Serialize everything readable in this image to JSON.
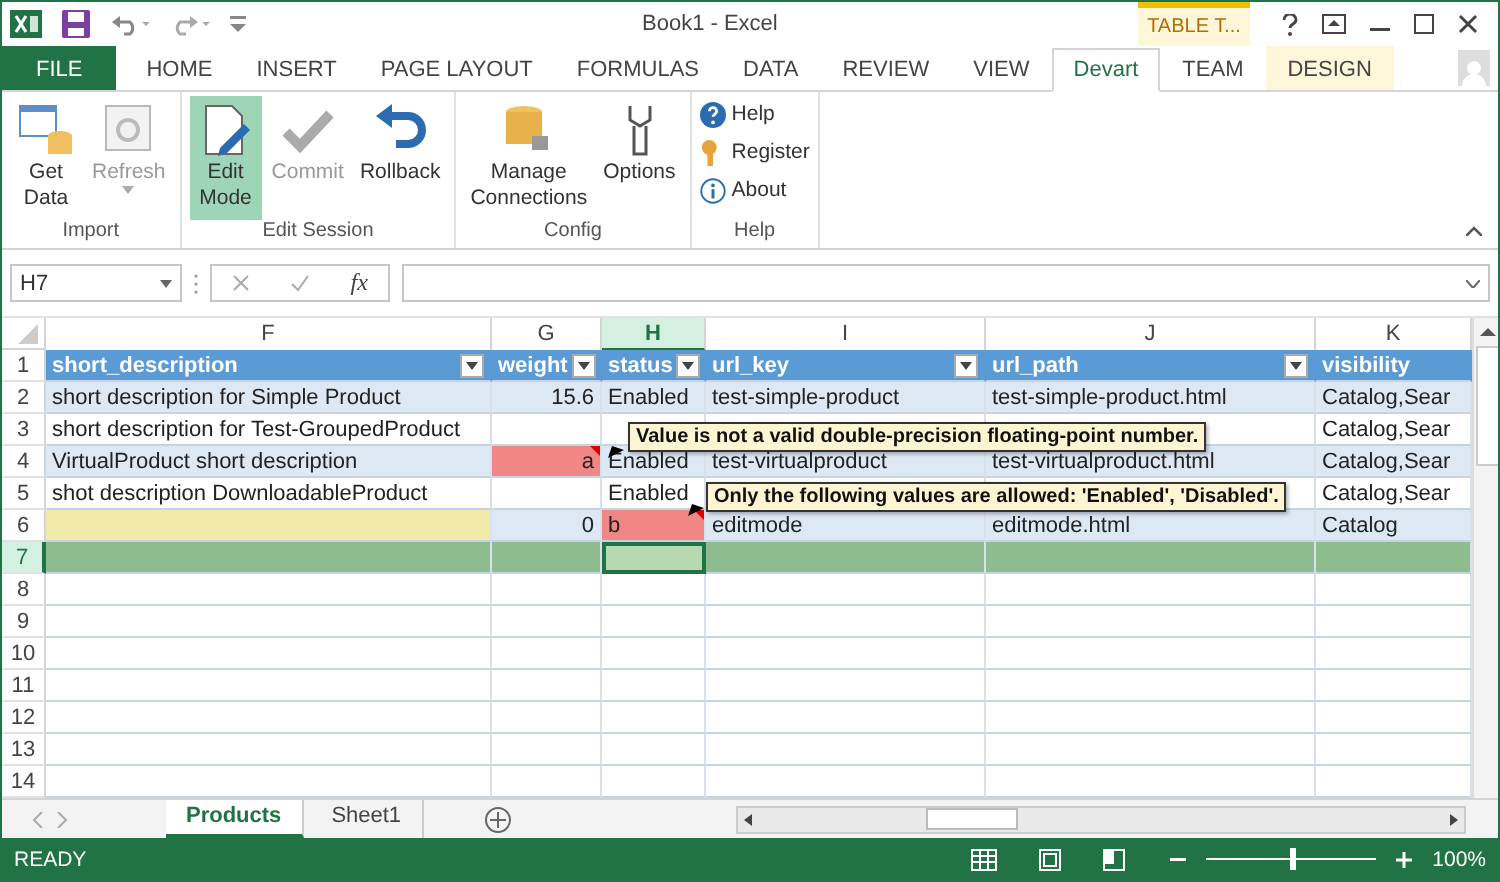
{
  "title_bar": {
    "title": "Book1 - Excel",
    "context_group": "TABLE T..."
  },
  "ribbon_tabs": [
    {
      "label": "FILE",
      "kind": "file",
      "selected": false
    },
    {
      "label": "HOME",
      "kind": "tab",
      "selected": false
    },
    {
      "label": "INSERT",
      "kind": "tab",
      "selected": false
    },
    {
      "label": "PAGE LAYOUT",
      "kind": "tab",
      "selected": false
    },
    {
      "label": "FORMULAS",
      "kind": "tab",
      "selected": false
    },
    {
      "label": "DATA",
      "kind": "tab",
      "selected": false
    },
    {
      "label": "REVIEW",
      "kind": "tab",
      "selected": false
    },
    {
      "label": "VIEW",
      "kind": "tab",
      "selected": false
    },
    {
      "label": "Devart",
      "kind": "tab",
      "selected": true
    },
    {
      "label": "TEAM",
      "kind": "tab",
      "selected": false
    },
    {
      "label": "DESIGN",
      "kind": "contextual",
      "selected": false
    }
  ],
  "ribbon_groups": [
    {
      "label": "Import",
      "kind": "large",
      "buttons": [
        {
          "label": "Get Data",
          "kind": "get-data",
          "disabled": false,
          "selected": false,
          "dropdown": false
        },
        {
          "label": "Refresh",
          "kind": "refresh",
          "disabled": true,
          "selected": false,
          "dropdown": true
        }
      ]
    },
    {
      "label": "Edit Session",
      "kind": "large",
      "buttons": [
        {
          "label": "Edit Mode",
          "kind": "edit",
          "disabled": false,
          "selected": true,
          "dropdown": false
        },
        {
          "label": "Commit",
          "kind": "commit",
          "disabled": true,
          "selected": false,
          "dropdown": false
        },
        {
          "label": "Rollback",
          "kind": "rollback",
          "disabled": false,
          "selected": false,
          "dropdown": false
        }
      ]
    },
    {
      "label": "Config",
      "kind": "large",
      "buttons": [
        {
          "label": "Manage Connections",
          "kind": "connections",
          "disabled": false,
          "selected": false,
          "dropdown": false
        },
        {
          "label": "Options",
          "kind": "options",
          "disabled": false,
          "selected": false,
          "dropdown": false
        }
      ]
    },
    {
      "label": "Help",
      "kind": "small",
      "buttons": [
        {
          "label": "Help",
          "kind": "help",
          "disabled": false,
          "selected": false,
          "dropdown": false
        },
        {
          "label": "Register",
          "kind": "register",
          "disabled": false,
          "selected": false,
          "dropdown": false
        },
        {
          "label": "About",
          "kind": "about",
          "disabled": false,
          "selected": false,
          "dropdown": false
        }
      ]
    }
  ],
  "formula_bar": {
    "name_box": "H7",
    "function_label": "fx"
  },
  "columns": [
    {
      "letter": "F",
      "selected": false,
      "numeric": false
    },
    {
      "letter": "G",
      "selected": false,
      "numeric": true
    },
    {
      "letter": "H",
      "selected": true,
      "numeric": false
    },
    {
      "letter": "I",
      "selected": false,
      "numeric": false
    },
    {
      "letter": "J",
      "selected": false,
      "numeric": false
    },
    {
      "letter": "K",
      "selected": false,
      "numeric": false
    }
  ],
  "rows": [
    {
      "number": "1",
      "kind": "header",
      "selected": false,
      "cells": [
        {
          "text": "short_description",
          "kind": "normal",
          "filter": true
        },
        {
          "text": "weight",
          "kind": "normal",
          "filter": true
        },
        {
          "text": "status",
          "kind": "normal",
          "filter": true
        },
        {
          "text": "url_key",
          "kind": "normal",
          "filter": true
        },
        {
          "text": "url_path",
          "kind": "normal",
          "filter": true
        },
        {
          "text": "visibility",
          "kind": "normal",
          "filter": false
        }
      ]
    },
    {
      "number": "2",
      "kind": "band",
      "selected": false,
      "cells": [
        {
          "text": "short description for Simple Product",
          "kind": "normal"
        },
        {
          "text": "15.6",
          "kind": "normal"
        },
        {
          "text": "Enabled",
          "kind": "normal"
        },
        {
          "text": "test-simple-product",
          "kind": "normal"
        },
        {
          "text": "test-simple-product.html",
          "kind": "normal"
        },
        {
          "text": "Catalog,Sear",
          "kind": "normal"
        }
      ]
    },
    {
      "number": "3",
      "kind": "plain",
      "selected": false,
      "cells": [
        {
          "text": "short description for Test-GroupedProduct",
          "kind": "normal"
        },
        {
          "kind": "normal"
        },
        {
          "kind": "normal"
        },
        {
          "kind": "normal"
        },
        {
          "kind": "normal"
        },
        {
          "text": "Catalog,Sear",
          "kind": "normal"
        }
      ]
    },
    {
      "number": "4",
      "kind": "band",
      "selected": false,
      "cells": [
        {
          "text": "VirtualProduct  short description",
          "kind": "normal"
        },
        {
          "text": "a",
          "kind": "error"
        },
        {
          "text": "Enabled",
          "kind": "normal"
        },
        {
          "text": "test-virtualproduct",
          "kind": "normal"
        },
        {
          "text": "test-virtualproduct.html",
          "kind": "normal"
        },
        {
          "text": "Catalog,Sear",
          "kind": "normal"
        }
      ]
    },
    {
      "number": "5",
      "kind": "plain",
      "selected": false,
      "cells": [
        {
          "text": "shot description DownloadableProduct",
          "kind": "normal"
        },
        {
          "kind": "normal"
        },
        {
          "text": "Enabled",
          "kind": "normal"
        },
        {
          "kind": "normal"
        },
        {
          "kind": "normal"
        },
        {
          "text": "Catalog,Sear",
          "kind": "normal"
        }
      ]
    },
    {
      "number": "6",
      "kind": "band",
      "selected": false,
      "cells": [
        {
          "kind": "edited"
        },
        {
          "text": "0",
          "kind": "normal"
        },
        {
          "text": "b",
          "kind": "error"
        },
        {
          "text": "editmode",
          "kind": "normal"
        },
        {
          "text": "editmode.html",
          "kind": "normal"
        },
        {
          "text": "Catalog",
          "kind": "normal"
        }
      ]
    },
    {
      "number": "7",
      "kind": "new",
      "selected": true,
      "cells": []
    },
    {
      "number": "8",
      "kind": "empty",
      "selected": false,
      "cells": []
    },
    {
      "number": "9",
      "kind": "empty",
      "selected": false,
      "cells": []
    },
    {
      "number": "10",
      "kind": "empty",
      "selected": false,
      "cells": []
    },
    {
      "number": "11",
      "kind": "empty",
      "selected": false,
      "cells": []
    },
    {
      "number": "12",
      "kind": "empty",
      "selected": false,
      "cells": []
    },
    {
      "number": "13",
      "kind": "empty",
      "selected": false,
      "cells": []
    },
    {
      "number": "14",
      "kind": "empty",
      "selected": false,
      "cells": []
    }
  ],
  "validation_tips": [
    "Value is not a valid double-precision floating-point number.",
    "Only the following values are allowed: 'Enabled', 'Disabled'."
  ],
  "sheet_tabs": [
    {
      "label": "Products",
      "selected": true
    },
    {
      "label": "Sheet1",
      "selected": false
    }
  ],
  "status_bar": {
    "status": "READY",
    "zoom": "100%",
    "level": 0.5
  }
}
